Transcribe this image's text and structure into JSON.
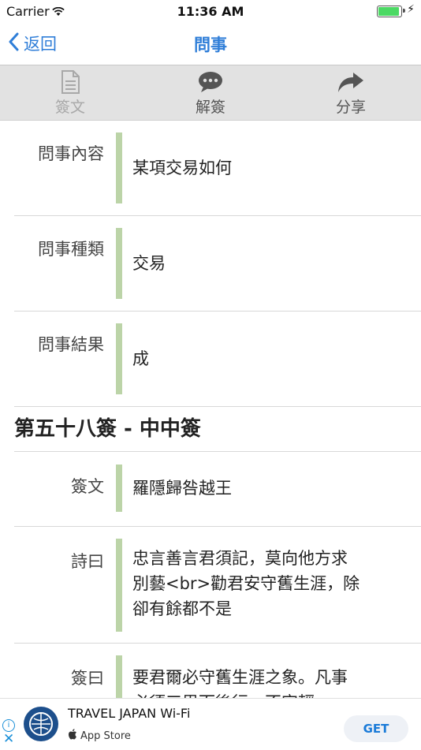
{
  "status": {
    "carrier": "Carrier",
    "time": "11:36 AM",
    "battery_level": 1.0
  },
  "nav": {
    "back_label": "返回",
    "title": "問事"
  },
  "toolbar": {
    "items": [
      {
        "label": "簽文",
        "icon": "document-icon",
        "enabled": false
      },
      {
        "label": "解簽",
        "icon": "chat-bubble-icon",
        "enabled": true
      },
      {
        "label": "分享",
        "icon": "share-arrow-icon",
        "enabled": true
      }
    ]
  },
  "inquiry": [
    {
      "key": "問事內容",
      "value": "某項交易如何"
    },
    {
      "key": "問事種類",
      "value": "交易"
    },
    {
      "key": "問事結果",
      "value": "成"
    }
  ],
  "fortune": {
    "title": "第五十八簽 - 中中簽",
    "rows": [
      {
        "key": "簽文",
        "value": "羅隱歸咎越王"
      },
      {
        "key": "詩曰",
        "value": "忠言善言君須記，莫向他方求別藝<br>勸君安守舊生涯，除卻有餘都不是"
      },
      {
        "key": "簽曰",
        "value": "要君爾必守舊生涯之象。凡事必須三思而後行，不宜輕"
      }
    ]
  },
  "ad": {
    "name": "TRAVEL JAPAN Wi-Fi",
    "store": "App Store",
    "cta": "GET",
    "info_icon": "info-icon",
    "close_icon": "close-icon"
  }
}
